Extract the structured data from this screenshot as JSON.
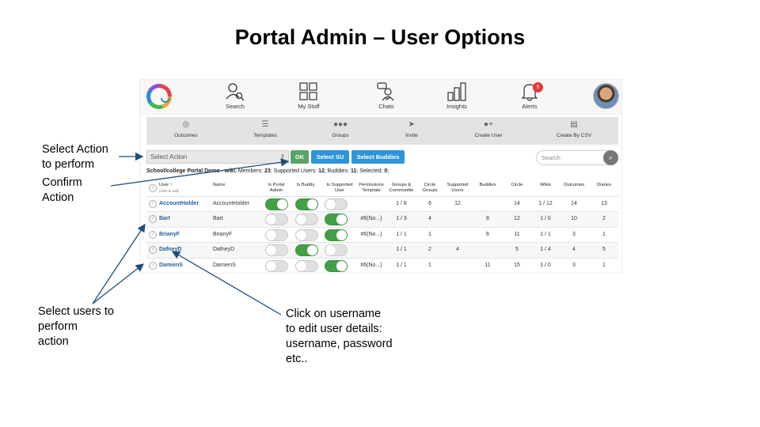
{
  "slide": {
    "title": "Portal Admin – User Options",
    "annotations": {
      "select_action_line1": "Select Action",
      "select_action_line2": "to perform",
      "confirm_line1": "Confirm",
      "confirm_line2": "Action",
      "select_users_line1": "Select users to",
      "select_users_line2": "perform",
      "select_users_line3": "action",
      "click_line1": "Click on username",
      "click_line2": "to edit user details:",
      "click_line3": "username, password",
      "click_line4": "etc.."
    }
  },
  "app": {
    "topnav": {
      "items": [
        {
          "label": "Search",
          "icon": "person-search-icon"
        },
        {
          "label": "My Stuff",
          "icon": "grid-icon"
        },
        {
          "label": "Chats",
          "icon": "chat-icon"
        },
        {
          "label": "Insights",
          "icon": "bar-chart-icon"
        },
        {
          "label": "Alerts",
          "icon": "bell-icon",
          "badge": "5"
        }
      ]
    },
    "subnav": {
      "items": [
        {
          "label": "Outcomes",
          "icon": "target-icon"
        },
        {
          "label": "Templates",
          "icon": "list-icon"
        },
        {
          "label": "Groups",
          "icon": "group-icon"
        },
        {
          "label": "Invite",
          "icon": "send-icon"
        },
        {
          "label": "Create User",
          "icon": "add-user-icon"
        },
        {
          "label": "Create By CSV",
          "icon": "document-icon"
        }
      ]
    },
    "toolbar": {
      "select_action": "Select Action",
      "ok": "OK",
      "select_su": "Select SU",
      "select_buddies": "Select Buddies",
      "search_placeholder": "Search"
    },
    "summary": {
      "name": "School/college Portal Demo - wiki.",
      "members_label": " Members: ",
      "members": "23",
      "supported_label": "; Supported Users: ",
      "supported": "12",
      "buddies_label": "; Buddies: ",
      "buddies": "11",
      "selected_label": "; Selected: ",
      "selected": "0",
      "end": ";"
    },
    "table": {
      "headers": {
        "user": "User ↑",
        "user_sub": "(click to edit)",
        "name": "Name",
        "is_portal_admin": "Is Portal Admin",
        "is_buddy": "Is Buddy",
        "is_supported_user": "Is Supported User",
        "permissions_template": "Permissions Template",
        "groups_communities": "Groups & Communitie",
        "circle_groups": "Circle Groups",
        "supported_users": "Supported Users",
        "buddies": "Buddies",
        "circle": "Circle",
        "wikis": "Wikis",
        "outcomes": "Outcomes",
        "diaries": "Diaries"
      },
      "rows": [
        {
          "user": "AccountHolder",
          "name": "AccountHolder",
          "admin": true,
          "buddy": true,
          "supported": false,
          "template": "",
          "groups": "1 / 8",
          "circle_groups": "6",
          "supported_users": "12",
          "buddies": "",
          "circle": "14",
          "wikis": "1 / 12",
          "outcomes": "14",
          "diaries": "13"
        },
        {
          "user": "Bart",
          "name": "Bart",
          "admin": false,
          "buddy": false,
          "supported": true,
          "template": "#6(No...)",
          "groups": "1 / 3",
          "circle_groups": "4",
          "supported_users": "",
          "buddies": "8",
          "circle": "12",
          "wikis": "1 / 0",
          "outcomes": "10",
          "diaries": "2"
        },
        {
          "user": "BrianyF",
          "name": "BrianyF",
          "admin": false,
          "buddy": false,
          "supported": true,
          "template": "#6(No...)",
          "groups": "1 / 1",
          "circle_groups": "1",
          "supported_users": "",
          "buddies": "6",
          "circle": "11",
          "wikis": "1 / 1",
          "outcomes": "3",
          "diaries": "1"
        },
        {
          "user": "DafneyD",
          "name": "DafneyD",
          "admin": false,
          "buddy": true,
          "supported": false,
          "template": "",
          "groups": "1 / 1",
          "circle_groups": "2",
          "supported_users": "4",
          "buddies": "",
          "circle": "5",
          "wikis": "1 / 4",
          "outcomes": "4",
          "diaries": "5"
        },
        {
          "user": "DamienS",
          "name": "DamienS",
          "admin": false,
          "buddy": false,
          "supported": true,
          "template": "#6(No...)",
          "groups": "1 / 1",
          "circle_groups": "1",
          "supported_users": "",
          "buddies": "11",
          "circle": "15",
          "wikis": "1 / 0",
          "outcomes": "3",
          "diaries": "1"
        }
      ]
    }
  }
}
